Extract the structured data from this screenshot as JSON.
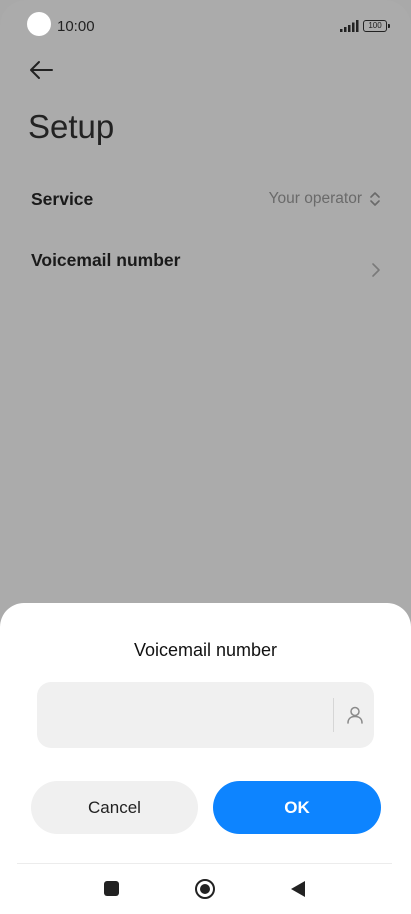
{
  "status_bar": {
    "time": "10:00",
    "battery": "100",
    "icons": [
      "camera-dot",
      "signal-icon",
      "battery-icon"
    ]
  },
  "header": {
    "back_icon": "arrow-left-icon",
    "title": "Setup"
  },
  "settings": {
    "service": {
      "label": "Service",
      "value": "Your operator",
      "icon": "up-down-chevron-icon"
    },
    "voicemail": {
      "label": "Voicemail number",
      "icon": "chevron-right-icon"
    }
  },
  "dialog": {
    "title": "Voicemail number",
    "input_value": "",
    "input_placeholder": "",
    "contact_icon": "person-icon",
    "cancel_label": "Cancel",
    "ok_label": "OK"
  },
  "nav_bar": {
    "icons": [
      "recents-square-icon",
      "home-circle-icon",
      "back-triangle-icon"
    ]
  },
  "colors": {
    "accent": "#0d84ff",
    "scrim": "#ababab",
    "sheet": "#ffffff",
    "input_bg": "#f0f0f0"
  }
}
